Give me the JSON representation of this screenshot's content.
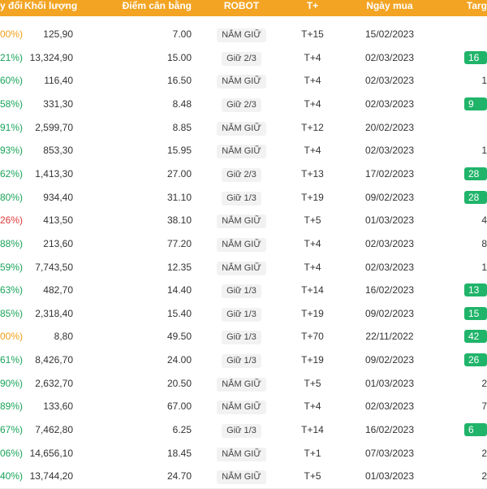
{
  "header": {
    "change": "y đổi",
    "volume": "Khối lượng",
    "balance_point": "Điểm cân bằng",
    "robot": "ROBOT",
    "t_plus": "T+",
    "buy_date": "Ngày mua",
    "target": "Targ"
  },
  "colors": {
    "header_bg": "#f3a423",
    "positive": "#1aa35a",
    "reference": "#f0a018",
    "negative": "#e03a3a",
    "badge": "#20b46a"
  },
  "rows": [
    {
      "change": "00%)",
      "status": "ref",
      "volume": "125,90",
      "balance": "7.00",
      "robot": "NẮM GIỮ",
      "tplus": "T+15",
      "date": "15/02/2023",
      "target": "",
      "target_badge": false
    },
    {
      "change": "21%)",
      "status": "pos",
      "volume": "13,324,90",
      "balance": "15.00",
      "robot": "Giữ 2/3",
      "tplus": "T+4",
      "date": "02/03/2023",
      "target": "16",
      "target_badge": true
    },
    {
      "change": "60%)",
      "status": "pos",
      "volume": "116,40",
      "balance": "16.50",
      "robot": "NẮM GIỮ",
      "tplus": "T+4",
      "date": "02/03/2023",
      "target": "1",
      "target_badge": false
    },
    {
      "change": "58%)",
      "status": "pos",
      "volume": "331,30",
      "balance": "8.48",
      "robot": "Giữ 2/3",
      "tplus": "T+4",
      "date": "02/03/2023",
      "target": "9",
      "target_badge": true
    },
    {
      "change": "91%)",
      "status": "pos",
      "volume": "2,599,70",
      "balance": "8.85",
      "robot": "NẮM GIỮ",
      "tplus": "T+12",
      "date": "20/02/2023",
      "target": "",
      "target_badge": false
    },
    {
      "change": "93%)",
      "status": "pos",
      "volume": "853,30",
      "balance": "15.95",
      "robot": "NẮM GIỮ",
      "tplus": "T+4",
      "date": "02/03/2023",
      "target": "1",
      "target_badge": false
    },
    {
      "change": "62%)",
      "status": "pos",
      "volume": "1,413,30",
      "balance": "27.00",
      "robot": "Giữ 2/3",
      "tplus": "T+13",
      "date": "17/02/2023",
      "target": "28",
      "target_badge": true
    },
    {
      "change": "80%)",
      "status": "pos",
      "volume": "934,40",
      "balance": "31.10",
      "robot": "Giữ 1/3",
      "tplus": "T+19",
      "date": "09/02/2023",
      "target": "28",
      "target_badge": true
    },
    {
      "change": "26%)",
      "status": "neg",
      "volume": "413,50",
      "balance": "38.10",
      "robot": "NẮM GIỮ",
      "tplus": "T+5",
      "date": "01/03/2023",
      "target": "4",
      "target_badge": false
    },
    {
      "change": "88%)",
      "status": "pos",
      "volume": "213,60",
      "balance": "77.20",
      "robot": "NẮM GIỮ",
      "tplus": "T+4",
      "date": "02/03/2023",
      "target": "8",
      "target_badge": false
    },
    {
      "change": "59%)",
      "status": "pos",
      "volume": "7,743,50",
      "balance": "12.35",
      "robot": "NẮM GIỮ",
      "tplus": "T+4",
      "date": "02/03/2023",
      "target": "1",
      "target_badge": false
    },
    {
      "change": "63%)",
      "status": "pos",
      "volume": "482,70",
      "balance": "14.40",
      "robot": "Giữ 1/3",
      "tplus": "T+14",
      "date": "16/02/2023",
      "target": "13",
      "target_badge": true
    },
    {
      "change": "85%)",
      "status": "pos",
      "volume": "2,318,40",
      "balance": "15.40",
      "robot": "Giữ 1/3",
      "tplus": "T+19",
      "date": "09/02/2023",
      "target": "15",
      "target_badge": true
    },
    {
      "change": "00%)",
      "status": "ref",
      "volume": "8,80",
      "balance": "49.50",
      "robot": "Giữ 1/3",
      "tplus": "T+70",
      "date": "22/11/2022",
      "target": "42",
      "target_badge": true
    },
    {
      "change": "61%)",
      "status": "pos",
      "volume": "8,426,70",
      "balance": "24.00",
      "robot": "Giữ 1/3",
      "tplus": "T+19",
      "date": "09/02/2023",
      "target": "26",
      "target_badge": true
    },
    {
      "change": "90%)",
      "status": "pos",
      "volume": "2,632,70",
      "balance": "20.50",
      "robot": "NẮM GIỮ",
      "tplus": "T+5",
      "date": "01/03/2023",
      "target": "2",
      "target_badge": false
    },
    {
      "change": "89%)",
      "status": "pos",
      "volume": "133,60",
      "balance": "67.00",
      "robot": "NẮM GIỮ",
      "tplus": "T+4",
      "date": "02/03/2023",
      "target": "7",
      "target_badge": false
    },
    {
      "change": "67%)",
      "status": "pos",
      "volume": "7,462,80",
      "balance": "6.25",
      "robot": "Giữ 1/3",
      "tplus": "T+14",
      "date": "16/02/2023",
      "target": "6",
      "target_badge": true
    },
    {
      "change": "06%)",
      "status": "pos",
      "volume": "14,656,10",
      "balance": "18.45",
      "robot": "NẮM GIỮ",
      "tplus": "T+1",
      "date": "07/03/2023",
      "target": "2",
      "target_badge": false
    },
    {
      "change": "40%)",
      "status": "pos",
      "volume": "13,744,20",
      "balance": "24.70",
      "robot": "NẮM GIỮ",
      "tplus": "T+5",
      "date": "01/03/2023",
      "target": "2",
      "target_badge": false
    }
  ]
}
